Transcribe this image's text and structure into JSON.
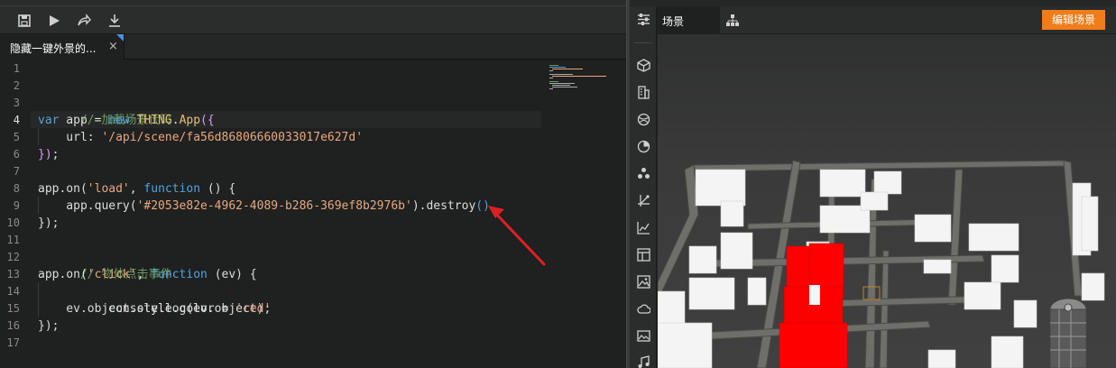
{
  "editor": {
    "tab": {
      "label": "隐藏一键外景的...",
      "close": "×"
    },
    "lines": [
      "1",
      "2",
      "3",
      "4",
      "5",
      "6",
      "7",
      "8",
      "9",
      "10",
      "11",
      "12",
      "13",
      "14",
      "15",
      "16",
      "17"
    ],
    "code": {
      "l3": "// 加载场景代码",
      "l4": {
        "kw": "var",
        "id1": " app = ",
        "kw2": "new",
        "cls": " THING",
        "pn": ".",
        "fn": "App",
        "par": "({"
      },
      "l5": {
        "key": "    url: ",
        "str": "'/api/scene/fa56d86806660033017e627d'"
      },
      "l6": {
        "par": "})",
        "pn": ";"
      },
      "l8": {
        "id": "app.on(",
        "str": "'load'",
        "pn": ", ",
        "kw": "function",
        "pn2": " () {"
      },
      "l9": {
        "id": "    app.query(",
        "str": "'#2053e82e-4962-4089-b286-369ef8b2976b'",
        "pn": ").destroy",
        "par": "()"
      },
      "l10": {
        "pn": "});"
      },
      "l12": "// 物体点击事件",
      "l13": {
        "id": "app.on(",
        "str": "'click'",
        "pn": ", ",
        "kw": "function",
        "pn2": " (ev) {"
      },
      "l14": "    console.log(ev.object);",
      "l15": {
        "id": "    ev.object.style.color = ",
        "str": "'red'"
      },
      "l16": {
        "pn": "});"
      }
    }
  },
  "right": {
    "scene_tab": "场景",
    "edit_button": "编辑场景"
  },
  "colors": {
    "accent": "#f07d1a",
    "arrow": "#e02020",
    "keyword": "#4fa3e0",
    "string": "#e8a97e",
    "comment": "#6b9b5a"
  },
  "icons": {
    "toolbar": [
      "save-icon",
      "run-icon",
      "share-icon",
      "download-icon"
    ],
    "sidebar": [
      "settings-sliders-icon",
      "cube-icon",
      "building-icon",
      "ball-icon",
      "clock-icon",
      "cluster-icon",
      "transform-icon",
      "chart-icon",
      "layout-icon",
      "image-icon",
      "cloud-icon",
      "picture-icon",
      "music-icon"
    ]
  }
}
